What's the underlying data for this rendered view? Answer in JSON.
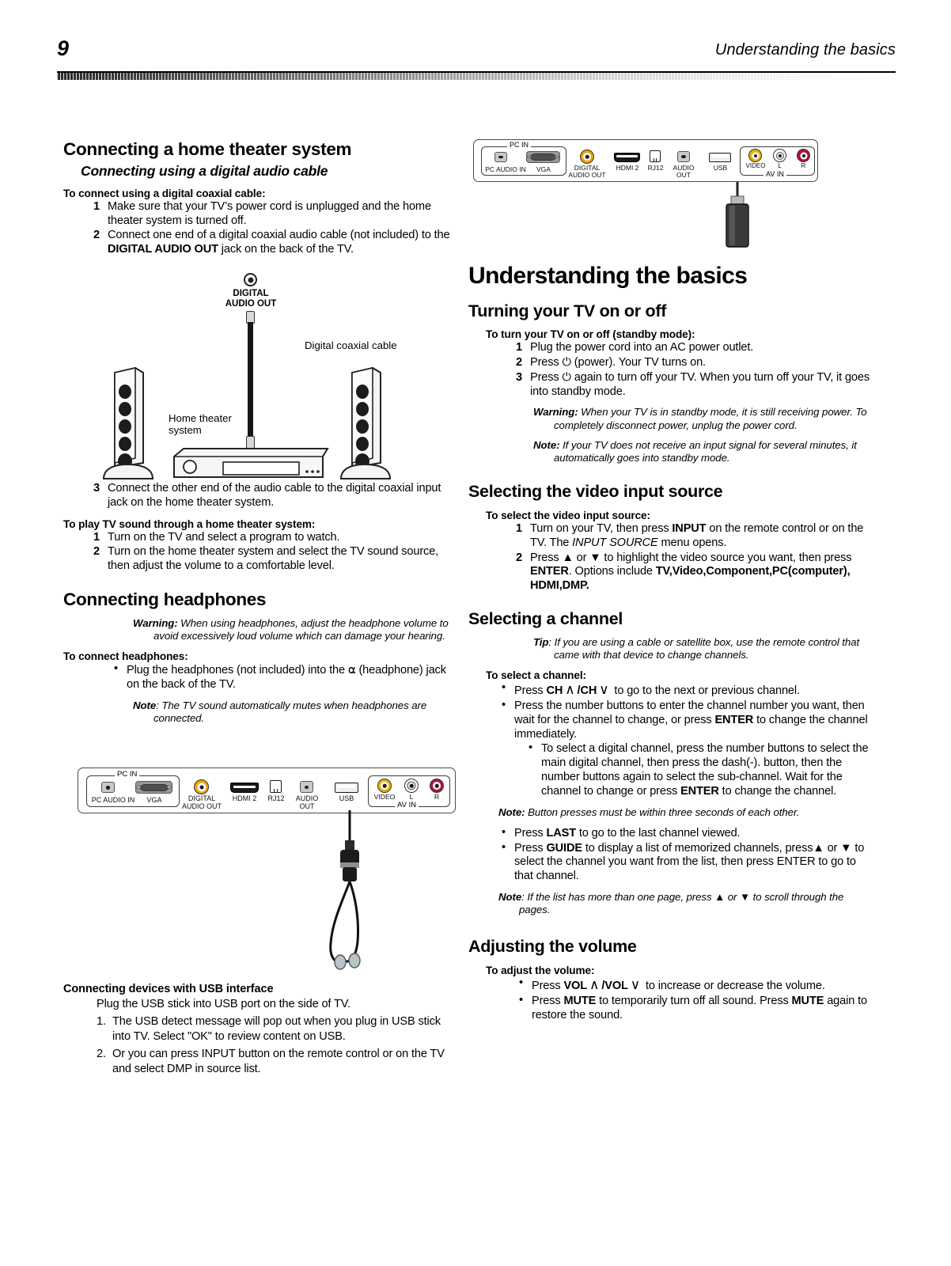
{
  "header": {
    "page_number": "9",
    "running_title": "Understanding the basics"
  },
  "left_column": {
    "section1_title": "Connecting a home theater system",
    "subsection1_title": "Connecting using a digital audio cable",
    "lead1": "To connect using a digital coaxial cable:",
    "steps1": [
      {
        "num": "1",
        "text": "Make sure that your TV’s power cord is unplugged and the home theater system is turned off."
      },
      {
        "num": "2",
        "text_pre": "Connect one end of a digital coaxial audio cable (not included) to the ",
        "bold": "DIGITAL AUDIO OUT",
        "text_post": " jack on the back of the TV."
      }
    ],
    "diagram1": {
      "jack_label_line1": "DIGITAL",
      "jack_label_line2": "AUDIO OUT",
      "cable_label": "Digital coaxial cable",
      "device_label_line1": "Home theater",
      "device_label_line2": "system"
    },
    "steps1b": [
      {
        "num": "3",
        "text": "Connect the other end of the audio cable to the digital coaxial input jack on the home theater system."
      }
    ],
    "lead2": "To play TV sound through a home theater system:",
    "steps2": [
      {
        "num": "1",
        "text": "Turn on the TV and select a program to watch."
      },
      {
        "num": "2",
        "text": "Turn on the home theater system and select the TV sound source, then adjust the volume to a comfortable level."
      }
    ],
    "section2_title": "Connecting headphones",
    "warning1_label": "Warning:",
    "warning1_text": " When using headphones, adjust the headphone volume to avoid excessively loud volume which can damage your hearing.",
    "lead3": "To connect headphones:",
    "bullets1": [
      {
        "pre": "Plug the headphones (not included) into the ",
        "icon": "headphone-glyph",
        "post": " (headphone) jack on the back of the TV."
      }
    ],
    "note1_label": "Note",
    "note1_text": ": The TV sound automatically mutes when headphones are connected.",
    "section3_title": "Connecting devices with USB interface",
    "usb_intro": "Plug the USB stick into USB port on the side of TV.",
    "usb_steps": [
      {
        "num": "1.",
        "text": "The USB detect message will pop out when you plug in USB stick into TV. Select \"OK\" to review content on USB."
      },
      {
        "num": "2.",
        "text": "Or you can press INPUT button on the remote control or on the TV and select DMP in source list."
      }
    ]
  },
  "right_column": {
    "section_title": "Understanding the basics",
    "h1": "Turning your TV on or off",
    "lead1": "To turn your TV on or off (standby mode):",
    "steps1": [
      {
        "num": "1",
        "text": "Plug the power cord into an AC power outlet."
      },
      {
        "num": "2",
        "pre": "Press ",
        "icon": "power-glyph",
        "post": " (power). Your TV turns on."
      },
      {
        "num": "3",
        "pre": "Press ",
        "icon": "power-glyph",
        "post": " again to turn off your TV. When you turn off your TV, it goes into standby mode."
      }
    ],
    "warning1_label": "Warning:",
    "warning1_text": " When your TV is in standby mode, it is still receiving power. To completely disconnect power, unplug the power cord.",
    "note1_label": "Note:",
    "note1_text": " If your TV does not receive an input signal for several minutes, it automatically goes into standby mode.",
    "h2": "Selecting the video input source",
    "lead2": "To select the video input source:",
    "steps2": [
      {
        "num": "1",
        "pre": "Turn on your TV, then press ",
        "bold": "INPUT",
        "mid": " on the remote control or on the TV. The ",
        "italic": "INPUT SOURCE",
        "post": " menu opens."
      },
      {
        "num": "2",
        "pre": "Press ▲ or ▼ to highlight the video source you want, then press ",
        "bold": "ENTER",
        "mid": ". Options include ",
        "bold2": "TV,Video,Component,PC(computer), HDMI,DMP.",
        "post": ""
      }
    ],
    "h3": "Selecting a channel",
    "tip_label": "Tip",
    "tip_text": ": If you are using a cable or satellite box, use the remote control that came with that device to change channels.",
    "lead3": "To select a channel:",
    "bullets3": [
      {
        "pre": "Press ",
        "bold": "CH",
        "chevron_up": "∧",
        "bold2": "/CH",
        "chevron_down": "∨",
        "post": " to go to the next or previous channel."
      },
      {
        "pre": "Press the number buttons to enter the channel number you want, then wait for the channel to change, or press ",
        "bold": "ENTER",
        "post": " to change the channel immediately."
      }
    ],
    "subbullet3": {
      "pre": "To select a digital channel, press the number buttons to select the main digital channel, then press the dash(-). button, then the number buttons again to select the sub-channel. Wait for the channel to change or press ",
      "bold": "ENTER",
      "post": " to change the channel."
    },
    "note3_label": "Note:",
    "note3_text": " Button presses must be within three seconds of each other.",
    "bullets4": [
      {
        "pre": "Press ",
        "bold": "LAST",
        "post": "  to go to the last channel viewed."
      },
      {
        "pre": "Press ",
        "bold": "GUIDE",
        "post": " to display a list of memorized channels, press▲ or ▼ to select the channel you want from the list, then press ENTER to go to that channel."
      }
    ],
    "note4_label": "Note",
    "note4_text": ": If the list has more than one page, press ▲ or ▼ to scroll through the pages.",
    "h4": "Adjusting the volume",
    "lead4": "To adjust the volume:",
    "bullets5": [
      {
        "pre": "Press ",
        "bold": "VOL",
        "chevron_up": "∧",
        "bold2": "/VOL",
        "chevron_down": "∨",
        "post": " to increase or decrease the volume."
      },
      {
        "pre": "Press ",
        "bold": "MUTE",
        "mid": " to temporarily turn off all sound. Press ",
        "bold2": "MUTE",
        "post": " again to restore the sound."
      }
    ]
  },
  "connector_panel": {
    "group_pc_in": "PC IN",
    "group_av_in": "AV IN",
    "jacks": [
      {
        "name": "pc-audio-in",
        "label": "PC AUDIO IN",
        "type": "minijack"
      },
      {
        "name": "vga",
        "label": "VGA",
        "type": "vga"
      },
      {
        "name": "digital-audio-out",
        "label": "DIGITAL\nAUDIO OUT",
        "type": "rca",
        "color": "#F0A500"
      },
      {
        "name": "hdmi-2",
        "label": "HDMI 2",
        "type": "hdmi"
      },
      {
        "name": "rj12",
        "label": "RJ12",
        "type": "rj12"
      },
      {
        "name": "audio-out",
        "label": "AUDIO\nOUT",
        "type": "minijack"
      },
      {
        "name": "usb",
        "label": "USB",
        "type": "usb"
      },
      {
        "name": "video",
        "label": "VIDEO",
        "type": "rca",
        "color": "#E8B500"
      },
      {
        "name": "audio-left",
        "label": "L",
        "type": "rca",
        "color": "#FFFFFF"
      },
      {
        "name": "audio-right",
        "label": "R",
        "type": "rca",
        "color": "#B3123B"
      }
    ],
    "label_digital": "DIGITAL",
    "label_audio_out_2": "AUDIO OUT",
    "label_hdmi2": "HDMI 2",
    "label_rj12": "RJ12",
    "label_audio": "AUDIO",
    "label_out": "OUT",
    "label_usb": "USB",
    "label_video": "VIDEO",
    "label_l": "L",
    "label_r": "R",
    "label_pc_audio_in": "PC AUDIO IN",
    "label_vga": "VGA"
  },
  "colors": {
    "rca_orange": "#F0A500",
    "rca_yellow": "#E8B500",
    "rca_white": "#FFFFFF",
    "rca_red": "#B3123B",
    "panel_stroke": "#4a4a4a",
    "text": "#000000"
  }
}
